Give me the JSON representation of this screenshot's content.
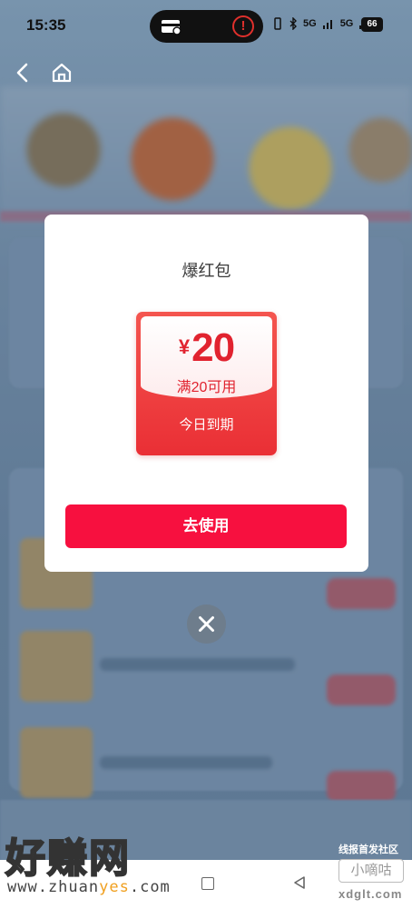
{
  "status_bar": {
    "time": "15:35",
    "battery": "66",
    "alert_glyph": "!",
    "network_1": "5G",
    "network_2": "5G"
  },
  "modal": {
    "title": "爆红包",
    "coupon": {
      "currency": "¥",
      "amount": "20",
      "condition": "满20可用",
      "expiry": "今日到期"
    },
    "use_button": "去使用"
  },
  "watermark": {
    "big": "好赚网",
    "url_prefix": "www.zhuan",
    "url_highlight": "yes",
    "url_suffix": ".com",
    "right_top": "线报首发社区",
    "right_mid": "小嘀咕",
    "right_bot": "xdglt.com"
  },
  "colors": {
    "primary": "#f7103f",
    "coupon_red": "#e1232f"
  }
}
